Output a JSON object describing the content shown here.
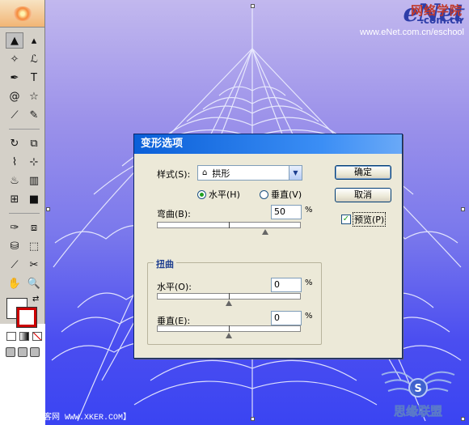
{
  "logo": {
    "brand": "eNet",
    "cn_text": "网络学院",
    "domain": ".com.cn",
    "url": "www.eNet.com.cn/eschool"
  },
  "toolbox": {
    "tools": [
      {
        "name": "selection-tool",
        "glyph": "▲",
        "active": true
      },
      {
        "name": "direct-selection-tool",
        "glyph": "▴"
      },
      {
        "name": "magic-wand-tool",
        "glyph": "✧"
      },
      {
        "name": "lasso-tool",
        "glyph": "ℒ"
      },
      {
        "name": "pen-tool",
        "glyph": "✒"
      },
      {
        "name": "type-tool",
        "glyph": "T"
      },
      {
        "name": "spiral-tool",
        "glyph": "@"
      },
      {
        "name": "star-tool",
        "glyph": "☆"
      },
      {
        "name": "paintbrush-tool",
        "glyph": "⟋"
      },
      {
        "name": "pencil-tool",
        "glyph": "✎"
      },
      {
        "name": "rotate-tool",
        "glyph": "↻"
      },
      {
        "name": "scale-tool",
        "glyph": "⧉"
      },
      {
        "name": "warp-tool",
        "glyph": "⌇"
      },
      {
        "name": "free-transform-tool",
        "glyph": "⊹"
      },
      {
        "name": "symbol-sprayer-tool",
        "glyph": "♨"
      },
      {
        "name": "column-graph-tool",
        "glyph": "▥"
      },
      {
        "name": "mesh-tool",
        "glyph": "⊞"
      },
      {
        "name": "gradient-tool",
        "glyph": "■"
      },
      {
        "name": "eyedropper-tool",
        "glyph": "✑"
      },
      {
        "name": "blend-tool",
        "glyph": "⧈"
      },
      {
        "name": "live-paint-bucket-tool",
        "glyph": "⛁"
      },
      {
        "name": "live-paint-selection-tool",
        "glyph": "⬚"
      },
      {
        "name": "slice-tool",
        "glyph": "⟋"
      },
      {
        "name": "scissors-tool",
        "glyph": "✂"
      },
      {
        "name": "hand-tool",
        "glyph": "✋"
      },
      {
        "name": "zoom-tool",
        "glyph": "🔍"
      }
    ]
  },
  "dialog": {
    "title": "变形选项",
    "style_label": "样式(S):",
    "style_value": "拱形",
    "horizontal_label": "水平(H)",
    "vertical_label": "垂直(V)",
    "orientation_selected": "horizontal",
    "bend_label": "弯曲(B):",
    "bend_value": "50",
    "bend_percent": 50,
    "distortion_title": "扭曲",
    "dist_h_label": "水平(O):",
    "dist_h_value": "0",
    "dist_h_percent": 0,
    "dist_v_label": "垂直(E):",
    "dist_v_value": "0",
    "dist_v_percent": 0,
    "percent_sign": "%",
    "ok_label": "确定",
    "cancel_label": "取消",
    "preview_label": "预览(P)",
    "preview_checked": true
  },
  "footer": {
    "upload_text": "上传于【新客网 WWW.XKER.COM】",
    "watermark_text": "思缘联盟"
  },
  "colors": {
    "canvas_top": "#c2b8ee",
    "canvas_bottom": "#3a44f2",
    "titlebar": "#0a5fd8"
  }
}
